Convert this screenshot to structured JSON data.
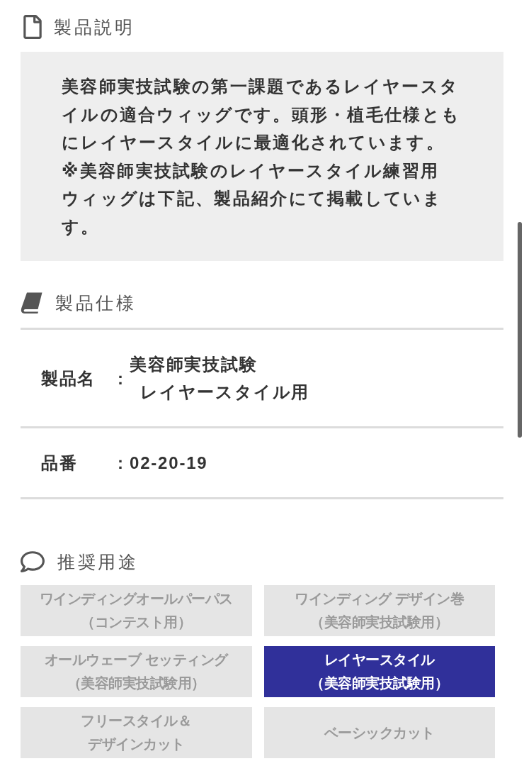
{
  "description": {
    "title": "製品説明",
    "paragraphs": [
      "美容師実技試験の第一課題であるレイヤースタイルの適合ウィッグです。頭形・植毛仕様ともにレイヤースタイルに最適化されています。",
      "※美容師実技試験のレイヤースタイル練習用ウィッグは下記、製品紹介にて掲載しています。"
    ]
  },
  "specifications": {
    "title": "製品仕様",
    "rows": [
      {
        "label": "製品名",
        "separator": ":",
        "value_lines": [
          "美容師実技試験",
          "レイヤースタイル用"
        ]
      },
      {
        "label": "品番",
        "separator": ":",
        "value_lines": [
          "02-20-19"
        ]
      }
    ]
  },
  "recommended_uses": {
    "title": "推奨用途",
    "items": [
      {
        "label_lines": [
          "ワインディングオールパーパス",
          "（コンテスト用）"
        ],
        "selected": false
      },
      {
        "label_lines": [
          "ワインディング デザイン巻",
          "（美容師実技試験用）"
        ],
        "selected": false
      },
      {
        "label_lines": [
          "オールウェーブ セッティング",
          "（美容師実技試験用）"
        ],
        "selected": false
      },
      {
        "label_lines": [
          "レイヤースタイル",
          "（美容師実技試験用）"
        ],
        "selected": true
      },
      {
        "label_lines": [
          "フリースタイル＆",
          "デザインカット"
        ],
        "selected": false
      },
      {
        "label_lines": [
          "ベーシックカット"
        ],
        "selected": false
      }
    ]
  }
}
